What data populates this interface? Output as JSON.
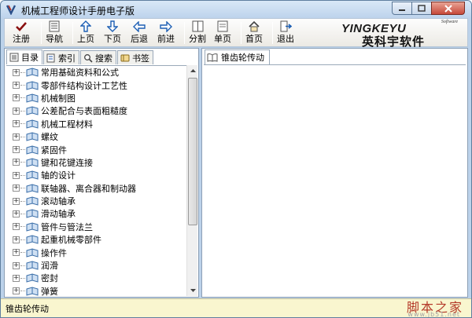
{
  "window": {
    "title": "机械工程师设计手册电子版",
    "accent": "#bcd2ea"
  },
  "toolbar": {
    "items": [
      {
        "label": "注册",
        "icon": "checkmark-icon"
      },
      {
        "label": "导航",
        "icon": "navigation-icon"
      },
      {
        "label": "上页",
        "icon": "arrow-up-icon"
      },
      {
        "label": "下页",
        "icon": "arrow-down-icon"
      },
      {
        "label": "后退",
        "icon": "arrow-left-icon"
      },
      {
        "label": "前进",
        "icon": "arrow-right-icon"
      },
      {
        "label": "分割",
        "icon": "split-icon"
      },
      {
        "label": "单页",
        "icon": "single-page-icon"
      },
      {
        "label": "首页",
        "icon": "home-icon"
      },
      {
        "label": "退出",
        "icon": "exit-icon"
      }
    ],
    "logo": {
      "software": "Software",
      "brand_en": "YINGKEYU",
      "brand_cn": "英科宇软件"
    }
  },
  "left_pane": {
    "tabs": [
      {
        "label": "目录",
        "icon": "contents-icon",
        "active": true
      },
      {
        "label": "索引",
        "icon": "index-icon",
        "active": false
      },
      {
        "label": "搜索",
        "icon": "search-icon",
        "active": false
      },
      {
        "label": "书签",
        "icon": "bookmark-icon",
        "active": false
      }
    ],
    "tree": [
      "常用基础资料和公式",
      "零部件结构设计工艺性",
      "机械制图",
      "公差配合与表面粗糙度",
      "机械工程材料",
      "螺纹",
      "紧固件",
      "键和花键连接",
      "轴的设计",
      "联轴器、离合器和制动器",
      "滚动轴承",
      "滑动轴承",
      "管件与管法兰",
      "起重机械零部件",
      "操作件",
      "润滑",
      "密封",
      "弹簧"
    ]
  },
  "right_pane": {
    "tab_label": "锥齿轮传动"
  },
  "status": {
    "text": "锥齿轮传动"
  },
  "watermark": {
    "cn": "脚本之家",
    "url": "www.jb51.net"
  }
}
